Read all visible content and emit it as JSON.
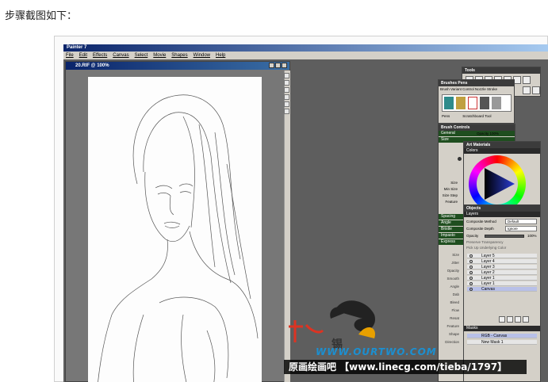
{
  "page": {
    "heading": "步骤截图如下："
  },
  "app": {
    "title": "Painter 7",
    "menu": [
      "File",
      "Edit",
      "Effects",
      "Canvas",
      "Select",
      "Movie",
      "Shapes",
      "Window",
      "Help"
    ],
    "document_title": "20.RIF @ 100%"
  },
  "panels": {
    "tools": {
      "title": "Tools"
    },
    "brushes": {
      "title": "Brushes Pens",
      "tabs": "Brush  Variant Control  Nozzle  Stroke",
      "variant": "Pens",
      "variant_name": "Scratchboard Tool"
    },
    "brush_controls": {
      "title": "Brush Controls",
      "general": "General",
      "opacity_label": "Opacity 100%",
      "size": "Size",
      "labels": [
        "Size",
        "Min Size",
        "Size Step",
        "Feature"
      ],
      "sections": [
        "Spacing",
        "Angle",
        "Bristle",
        "Impasto",
        "Express"
      ],
      "side_labels": [
        "Size",
        "Jitter",
        "Opacity",
        "Smooth",
        "Angle",
        "Dab",
        "Bleed",
        "Flow",
        "Resat",
        "Feature",
        "Shape",
        "Direction"
      ]
    },
    "art_materials": {
      "title": "Art Materials",
      "section": "Colors"
    },
    "objects": {
      "title": "Objects",
      "section": "Layers",
      "composite_method_label": "Composite Method",
      "composite_method": "Default",
      "composite_depth_label": "Composite Depth",
      "composite_depth": "Ignore",
      "opacity_label": "Opacity",
      "opacity_value": "100%",
      "preserve": "Preserve Transparency",
      "pick_up": "Pick Up Underlying Color",
      "layers": [
        "Layer 5",
        "Layer 4",
        "Layer 3",
        "Layer 2",
        "Layer 1",
        "Layer 1"
      ],
      "canvas_label": "Canvas",
      "masks_section": "Masks",
      "mask_rgb": "RGB - Canvas",
      "mask_new": "New Mask 1"
    }
  },
  "watermark": {
    "url": "WWW.OURTWO.COM",
    "xi": "锡",
    "text": "原画绘画吧 【www.linecg.com/tieba/1797】"
  },
  "colors": {
    "titlebar": "#0a246a",
    "panel_bg": "#d4d0c8",
    "section": "#1f4e1f"
  }
}
